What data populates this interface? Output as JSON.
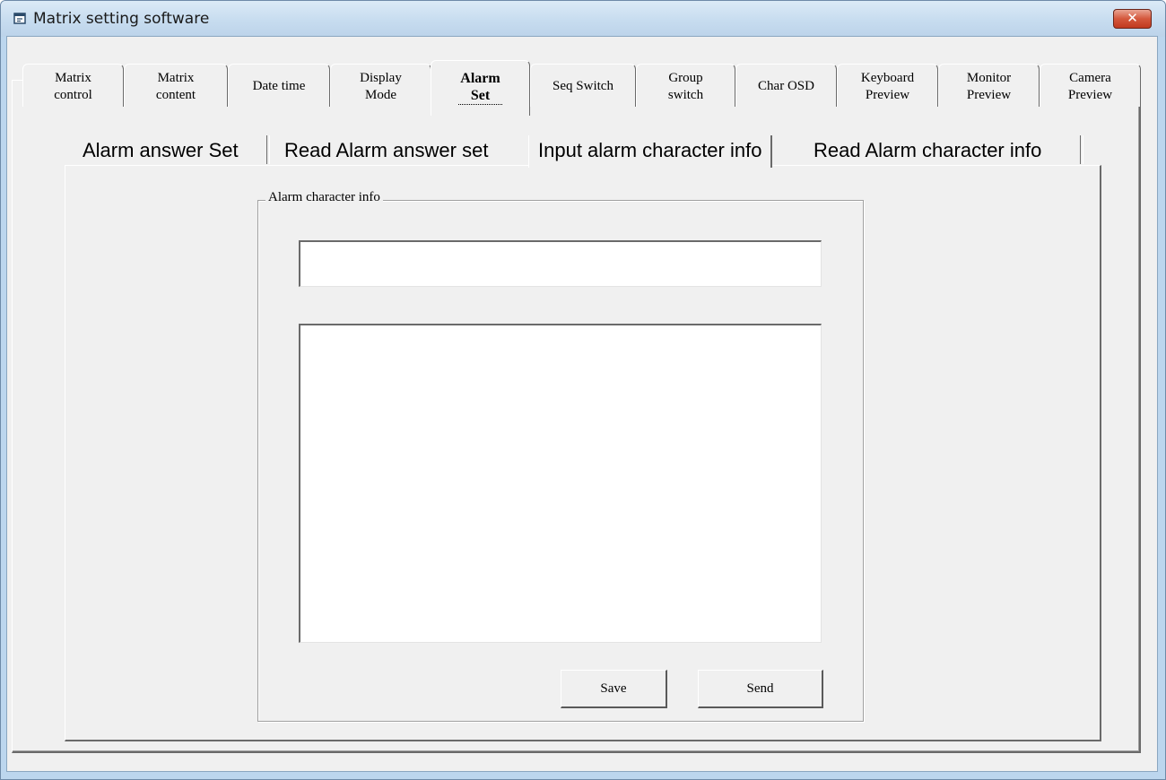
{
  "window": {
    "title": "Matrix setting software",
    "close_glyph": "✕"
  },
  "main_tabs": [
    {
      "label": "Matrix\ncontrol",
      "active": false
    },
    {
      "label": "Matrix\ncontent",
      "active": false
    },
    {
      "label": "Date  time",
      "active": false
    },
    {
      "label": "Display\nMode",
      "active": false
    },
    {
      "label": "Alarm\nSet",
      "active": true
    },
    {
      "label": "Seq Switch",
      "active": false
    },
    {
      "label": "Group\nswitch",
      "active": false
    },
    {
      "label": "Char OSD",
      "active": false
    },
    {
      "label": "Keyboard\nPreview",
      "active": false
    },
    {
      "label": "Monitor\nPreview",
      "active": false
    },
    {
      "label": "Camera\nPreview",
      "active": false
    }
  ],
  "sub_tabs": [
    {
      "label": "Alarm answer Set",
      "active": false
    },
    {
      "label": "Read Alarm answer set",
      "active": false
    },
    {
      "label": "Input alarm character info",
      "active": true
    },
    {
      "label": "Read Alarm character info",
      "active": false
    }
  ],
  "group": {
    "caption": "Alarm character info",
    "input_value": "",
    "text_value": "",
    "save_label": "Save",
    "send_label": "Send"
  },
  "colors": {
    "title_bar": "#c7dcef",
    "close_button": "#d4573c",
    "face": "#f0f0f0"
  },
  "icons": {
    "app": "window-app-icon",
    "close": "close-icon"
  }
}
